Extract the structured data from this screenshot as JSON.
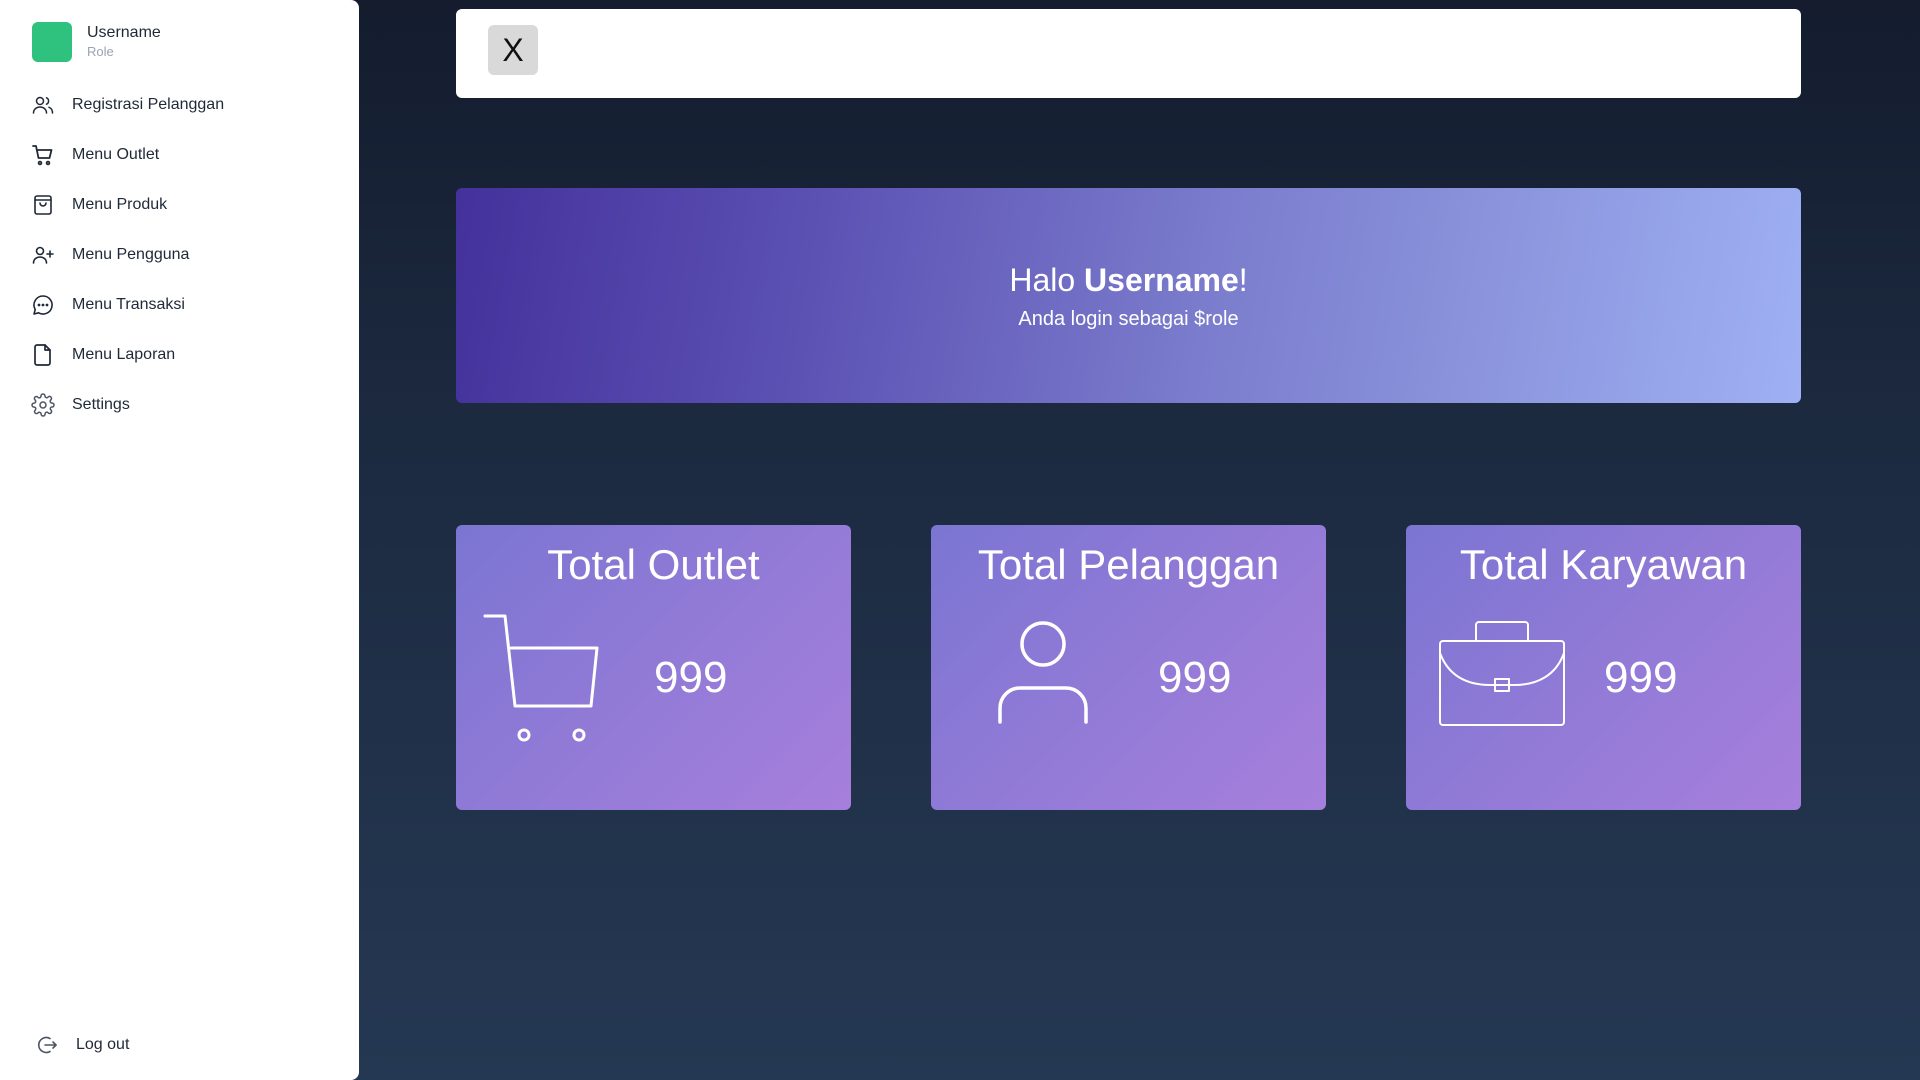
{
  "user": {
    "name": "Username",
    "role": "Role"
  },
  "sidebar": {
    "items": [
      {
        "label": "Registrasi Pelanggan",
        "icon": "users-icon"
      },
      {
        "label": "Menu Outlet",
        "icon": "cart-icon"
      },
      {
        "label": "Menu Produk",
        "icon": "shopping-bag-icon"
      },
      {
        "label": "Menu Pengguna",
        "icon": "user-plus-icon"
      },
      {
        "label": "Menu Transaksi",
        "icon": "chat-icon"
      },
      {
        "label": "Menu Laporan",
        "icon": "file-icon"
      },
      {
        "label": "Settings",
        "icon": "gear-icon"
      }
    ],
    "logout": {
      "label": "Log out",
      "icon": "logout-icon"
    }
  },
  "topbar": {
    "close_label": "X"
  },
  "hero": {
    "greeting": "Halo ",
    "username": "Username",
    "exclaim": "!",
    "subtitle": "Anda login sebagai $role"
  },
  "stats": [
    {
      "title": "Total Outlet",
      "value": "999",
      "icon": "cart-icon"
    },
    {
      "title": "Total Pelanggan",
      "value": "999",
      "icon": "user-icon"
    },
    {
      "title": "Total Karyawan",
      "value": "999",
      "icon": "briefcase-icon"
    }
  ],
  "colors": {
    "avatar": "#2ec27e",
    "background_top": "#141c2e",
    "background_bottom": "#253853",
    "hero_start": "#44319b",
    "hero_end": "#9fb0f4",
    "card_start": "#7b75d2",
    "card_end": "#a77fdc"
  }
}
